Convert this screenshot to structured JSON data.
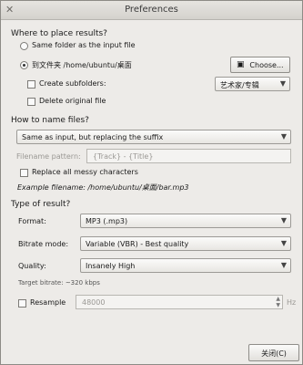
{
  "window": {
    "title": "Preferences"
  },
  "where": {
    "heading": "Where to place results?",
    "same_folder_label": "Same folder as the input file",
    "to_folder_label": "到文件夹 /home/ubuntu/桌面",
    "choose_label": "Choose...",
    "create_subfolders_label": "Create subfolders:",
    "subfolder_pattern_value": "艺术家/专辑",
    "delete_original_label": "Delete original file"
  },
  "naming": {
    "heading": "How to name files?",
    "naming_mode_value": "Same as input, but replacing the suffix",
    "filename_pattern_label": "Filename pattern:",
    "filename_pattern_placeholder": "{Track} - {Title}",
    "replace_messy_label": "Replace all messy characters",
    "example_label": "Example filename: /home/ubuntu/桌面/bar.mp3"
  },
  "result": {
    "heading": "Type of result?",
    "format_label": "Format:",
    "format_value": "MP3 (.mp3)",
    "bitrate_mode_label": "Bitrate mode:",
    "bitrate_mode_value": "Variable (VBR) - Best quality",
    "quality_label": "Quality:",
    "quality_value": "Insanely High",
    "target_bitrate_label": "Target bitrate: ~320 kbps",
    "resample_label": "Resample",
    "resample_value": "48000",
    "hz_label": "Hz"
  },
  "footer": {
    "close_label": "关闭(C)"
  }
}
